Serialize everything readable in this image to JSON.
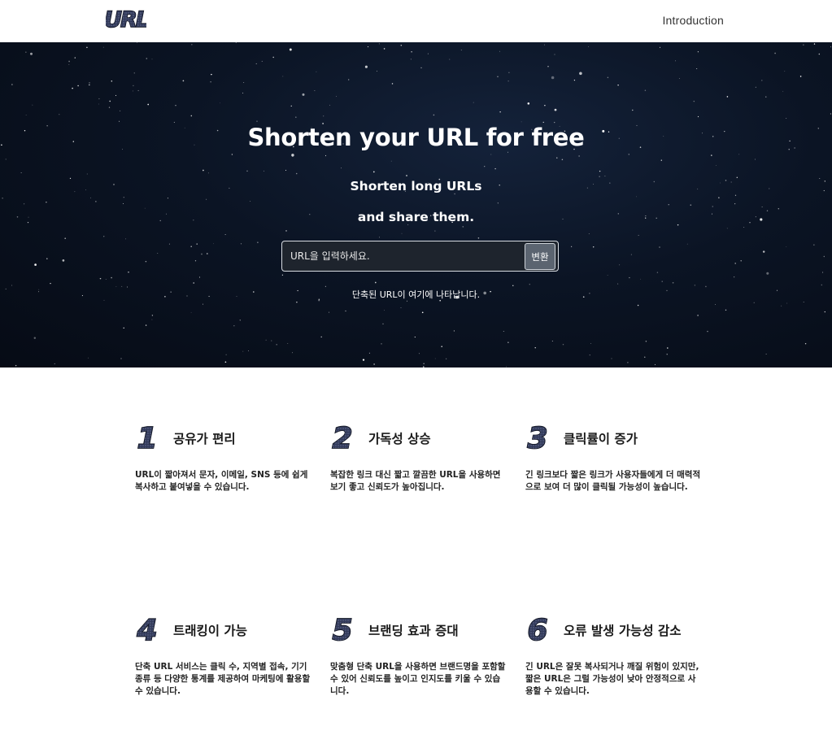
{
  "header": {
    "logo_text": "URL",
    "nav_introduction": "Introduction"
  },
  "hero": {
    "title": "Shorten your URL for free",
    "subtitle_line1": "Shorten long URLs",
    "subtitle_line2": "and share them.",
    "input_placeholder": "URL을 입력하세요.",
    "button_label": "변환",
    "result_text": "단축된 URL이 여기에 나타납니다."
  },
  "features": [
    {
      "number": "1",
      "icon": "number-1-icon",
      "title": "공유가 편리",
      "desc": "URL이 짧아져서 문자, 이메일, SNS 등에 쉽게 복사하고 붙여넣을 수 있습니다."
    },
    {
      "number": "2",
      "icon": "number-2-icon",
      "title": "가독성 상승",
      "desc": "복잡한 링크 대신 짧고 깔끔한 URL을 사용하면 보기 좋고 신뢰도가 높아집니다."
    },
    {
      "number": "3",
      "icon": "number-3-icon",
      "title": "클릭률이 증가",
      "desc": "긴 링크보다 짧은 링크가 사용자들에게 더 매력적으로 보여 더 많이 클릭될 가능성이 높습니다."
    },
    {
      "number": "4",
      "icon": "number-4-icon",
      "title": "트래킹이 가능",
      "desc": "단축 URL 서비스는 클릭 수, 지역별 접속, 기기 종류 등 다양한 통계를 제공하여 마케팅에 활용할 수 있습니다."
    },
    {
      "number": "5",
      "icon": "number-5-icon",
      "title": "브랜딩 효과 증대",
      "desc": "맞춤형 단축 URL을 사용하면 브랜드명을 포함할 수 있어 신뢰도를 높이고 인지도를 키울 수 있습니다."
    },
    {
      "number": "6",
      "icon": "number-6-icon",
      "title": "오류 발생 가능성 감소",
      "desc": "긴 URL은 잘못 복사되거나 깨질 위험이 있지만, 짧은 URL은 그럴 가능성이 낮아 안정적으로 사용할 수 있습니다."
    }
  ],
  "colors": {
    "hero_bg": "#0b1424",
    "icon_fill": "#2b3350",
    "icon_stroke": "#111522",
    "button_bg": "#5b6470"
  }
}
